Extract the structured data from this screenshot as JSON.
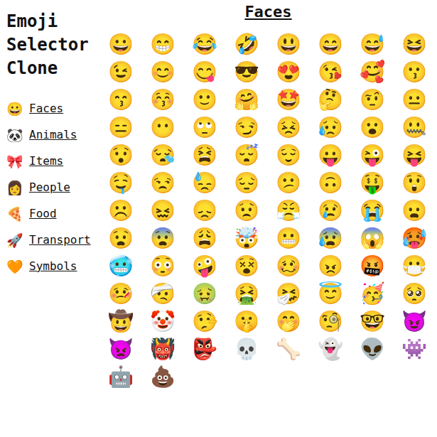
{
  "sidebar": {
    "title": "Emoji Selector Clone",
    "items": [
      {
        "icon": "😀",
        "label": "Faces"
      },
      {
        "icon": "🐼",
        "label": "Animals"
      },
      {
        "icon": "🎀",
        "label": "Items"
      },
      {
        "icon": "👩",
        "label": "People"
      },
      {
        "icon": "🍕",
        "label": "Food"
      },
      {
        "icon": "🚀",
        "label": "Transport"
      },
      {
        "icon": "🧡",
        "label": "Symbols"
      }
    ]
  },
  "main": {
    "heading": "Faces",
    "emojis": [
      "😀",
      "😁",
      "😂",
      "🤣",
      "😃",
      "😄",
      "😅",
      "😆",
      "😉",
      "😊",
      "😋",
      "😎",
      "😍",
      "😘",
      "🥰",
      "😗",
      "😙",
      "😚",
      "🙂",
      "🤗",
      "🤩",
      "🤔",
      "🤨",
      "😐",
      "😑",
      "😶",
      "🙄",
      "😏",
      "😣",
      "😥",
      "😮",
      "🤐",
      "😯",
      "😪",
      "😫",
      "😴",
      "😌",
      "😛",
      "😜",
      "😝",
      "🤤",
      "😒",
      "😓",
      "😔",
      "😕",
      "🙃",
      "🤑",
      "😲",
      "☹️",
      "😖",
      "😞",
      "😟",
      "😤",
      "😢",
      "😭",
      "😦",
      "😧",
      "😨",
      "😩",
      "🤯",
      "😬",
      "😰",
      "😱",
      "🥵",
      "🥶",
      "😳",
      "🤪",
      "😵",
      "🥴",
      "😠",
      "🤬",
      "😷",
      "🤒",
      "🤕",
      "🤢",
      "🤮",
      "🤧",
      "😇",
      "🥳",
      "🥺",
      "🤠",
      "🤡",
      "🤥",
      "🤫",
      "🤭",
      "🧐",
      "🤓",
      "😈",
      "👿",
      "👹",
      "👺",
      "💀",
      "🦴",
      "👻",
      "👽",
      "👾",
      "🤖",
      "💩"
    ]
  }
}
